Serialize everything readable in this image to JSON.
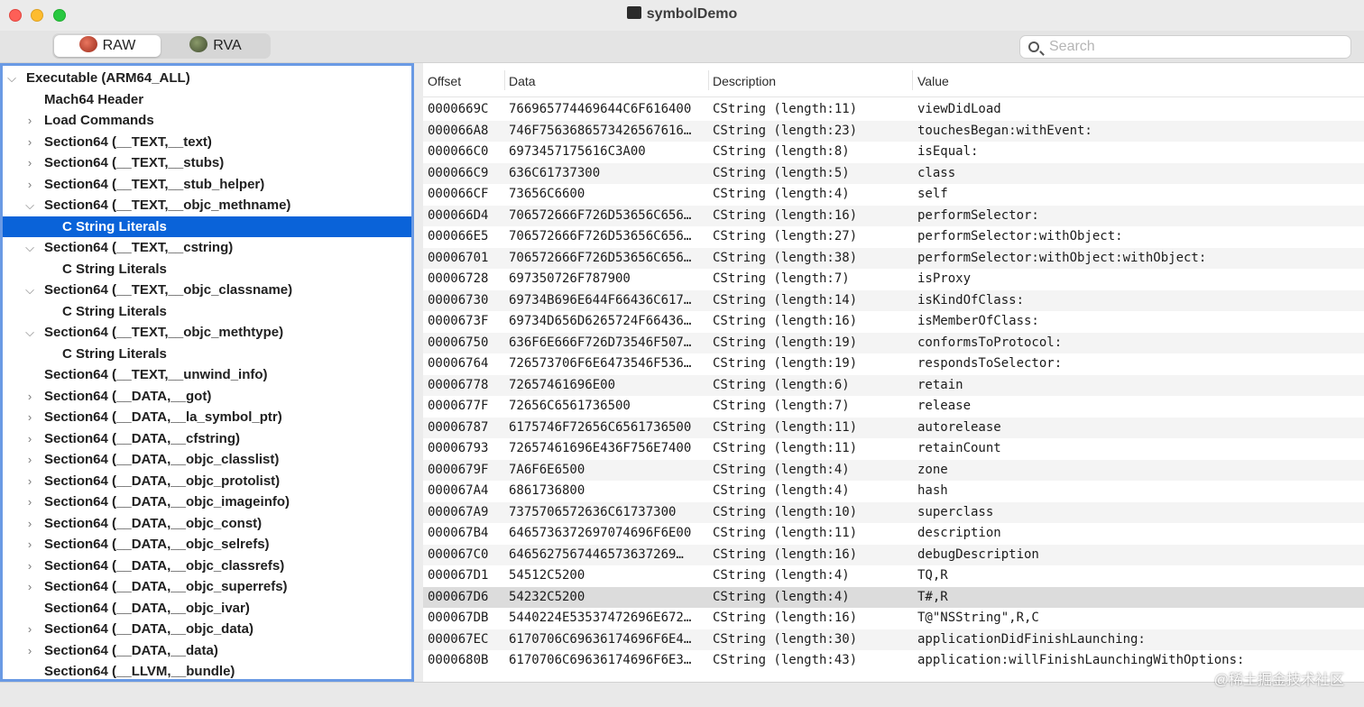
{
  "window": {
    "title": "symbolDemo"
  },
  "toolbar": {
    "raw_label": "RAW",
    "rva_label": "RVA",
    "search_placeholder": "Search"
  },
  "tree": [
    {
      "label": "Executable  (ARM64_ALL)",
      "level": 0,
      "disclosure": "open"
    },
    {
      "label": "Mach64 Header",
      "level": 1,
      "disclosure": "none"
    },
    {
      "label": "Load Commands",
      "level": 1,
      "disclosure": "closed"
    },
    {
      "label": "Section64 (__TEXT,__text)",
      "level": 1,
      "disclosure": "closed"
    },
    {
      "label": "Section64 (__TEXT,__stubs)",
      "level": 1,
      "disclosure": "closed"
    },
    {
      "label": "Section64 (__TEXT,__stub_helper)",
      "level": 1,
      "disclosure": "closed"
    },
    {
      "label": "Section64 (__TEXT,__objc_methname)",
      "level": 1,
      "disclosure": "open"
    },
    {
      "label": "C String Literals",
      "level": 2,
      "disclosure": "none",
      "selected": true
    },
    {
      "label": "Section64 (__TEXT,__cstring)",
      "level": 1,
      "disclosure": "open"
    },
    {
      "label": "C String Literals",
      "level": 2,
      "disclosure": "none"
    },
    {
      "label": "Section64 (__TEXT,__objc_classname)",
      "level": 1,
      "disclosure": "open"
    },
    {
      "label": "C String Literals",
      "level": 2,
      "disclosure": "none"
    },
    {
      "label": "Section64 (__TEXT,__objc_methtype)",
      "level": 1,
      "disclosure": "open"
    },
    {
      "label": "C String Literals",
      "level": 2,
      "disclosure": "none"
    },
    {
      "label": "Section64 (__TEXT,__unwind_info)",
      "level": 1,
      "disclosure": "none"
    },
    {
      "label": "Section64 (__DATA,__got)",
      "level": 1,
      "disclosure": "closed"
    },
    {
      "label": "Section64 (__DATA,__la_symbol_ptr)",
      "level": 1,
      "disclosure": "closed"
    },
    {
      "label": "Section64 (__DATA,__cfstring)",
      "level": 1,
      "disclosure": "closed"
    },
    {
      "label": "Section64 (__DATA,__objc_classlist)",
      "level": 1,
      "disclosure": "closed"
    },
    {
      "label": "Section64 (__DATA,__objc_protolist)",
      "level": 1,
      "disclosure": "closed"
    },
    {
      "label": "Section64 (__DATA,__objc_imageinfo)",
      "level": 1,
      "disclosure": "closed"
    },
    {
      "label": "Section64 (__DATA,__objc_const)",
      "level": 1,
      "disclosure": "closed"
    },
    {
      "label": "Section64 (__DATA,__objc_selrefs)",
      "level": 1,
      "disclosure": "closed"
    },
    {
      "label": "Section64 (__DATA,__objc_classrefs)",
      "level": 1,
      "disclosure": "closed"
    },
    {
      "label": "Section64 (__DATA,__objc_superrefs)",
      "level": 1,
      "disclosure": "closed"
    },
    {
      "label": "Section64 (__DATA,__objc_ivar)",
      "level": 1,
      "disclosure": "none"
    },
    {
      "label": "Section64 (__DATA,__objc_data)",
      "level": 1,
      "disclosure": "closed"
    },
    {
      "label": "Section64 (__DATA,__data)",
      "level": 1,
      "disclosure": "closed"
    },
    {
      "label": "Section64 (__LLVM,__bundle)",
      "level": 1,
      "disclosure": "none"
    }
  ],
  "table": {
    "columns": {
      "offset": "Offset",
      "data": "Data",
      "description": "Description",
      "value": "Value"
    },
    "rows": [
      {
        "offset": "0000669C",
        "data": "766965774469644C6F616400",
        "description": "CString (length:11)",
        "value": "viewDidLoad"
      },
      {
        "offset": "000066A8",
        "data": "746F7563686573426567616…",
        "description": "CString (length:23)",
        "value": "touchesBegan:withEvent:"
      },
      {
        "offset": "000066C0",
        "data": "6973457175616C3A00",
        "description": "CString (length:8)",
        "value": "isEqual:"
      },
      {
        "offset": "000066C9",
        "data": "636C61737300",
        "description": "CString (length:5)",
        "value": "class"
      },
      {
        "offset": "000066CF",
        "data": "73656C6600",
        "description": "CString (length:4)",
        "value": "self"
      },
      {
        "offset": "000066D4",
        "data": "706572666F726D53656C656…",
        "description": "CString (length:16)",
        "value": "performSelector:"
      },
      {
        "offset": "000066E5",
        "data": "706572666F726D53656C656…",
        "description": "CString (length:27)",
        "value": "performSelector:withObject:"
      },
      {
        "offset": "00006701",
        "data": "706572666F726D53656C656…",
        "description": "CString (length:38)",
        "value": "performSelector:withObject:withObject:"
      },
      {
        "offset": "00006728",
        "data": "697350726F787900",
        "description": "CString (length:7)",
        "value": "isProxy"
      },
      {
        "offset": "00006730",
        "data": "69734B696E644F66436C617…",
        "description": "CString (length:14)",
        "value": "isKindOfClass:"
      },
      {
        "offset": "0000673F",
        "data": "69734D656D6265724F66436…",
        "description": "CString (length:16)",
        "value": "isMemberOfClass:"
      },
      {
        "offset": "00006750",
        "data": "636F6E666F726D73546F507…",
        "description": "CString (length:19)",
        "value": "conformsToProtocol:"
      },
      {
        "offset": "00006764",
        "data": "726573706F6E6473546F536…",
        "description": "CString (length:19)",
        "value": "respondsToSelector:"
      },
      {
        "offset": "00006778",
        "data": "72657461696E00",
        "description": "CString (length:6)",
        "value": "retain"
      },
      {
        "offset": "0000677F",
        "data": "72656C6561736500",
        "description": "CString (length:7)",
        "value": "release"
      },
      {
        "offset": "00006787",
        "data": "6175746F72656C6561736500",
        "description": "CString (length:11)",
        "value": "autorelease"
      },
      {
        "offset": "00006793",
        "data": "72657461696E436F756E7400",
        "description": "CString (length:11)",
        "value": "retainCount"
      },
      {
        "offset": "0000679F",
        "data": "7A6F6E6500",
        "description": "CString (length:4)",
        "value": "zone"
      },
      {
        "offset": "000067A4",
        "data": "6861736800",
        "description": "CString (length:4)",
        "value": "hash"
      },
      {
        "offset": "000067A9",
        "data": "7375706572636C61737300",
        "description": "CString (length:10)",
        "value": "superclass"
      },
      {
        "offset": "000067B4",
        "data": "6465736372697074696F6E00",
        "description": "CString (length:11)",
        "value": "description"
      },
      {
        "offset": "000067C0",
        "data": "6465627567446573637269…",
        "description": "CString (length:16)",
        "value": "debugDescription"
      },
      {
        "offset": "000067D1",
        "data": "54512C5200",
        "description": "CString (length:4)",
        "value": "TQ,R"
      },
      {
        "offset": "000067D6",
        "data": "54232C5200",
        "description": "CString (length:4)",
        "value": "T#,R",
        "highlight": true
      },
      {
        "offset": "000067DB",
        "data": "5440224E53537472696E672…",
        "description": "CString (length:16)",
        "value": "T@\"NSString\",R,C"
      },
      {
        "offset": "000067EC",
        "data": "6170706C69636174696F6E4…",
        "description": "CString (length:30)",
        "value": "applicationDidFinishLaunching:"
      },
      {
        "offset": "0000680B",
        "data": "6170706C69636174696F6E3…",
        "description": "CString (length:43)",
        "value": "application:willFinishLaunchingWithOptions:"
      }
    ]
  },
  "watermark": "@稀土掘金技术社区"
}
